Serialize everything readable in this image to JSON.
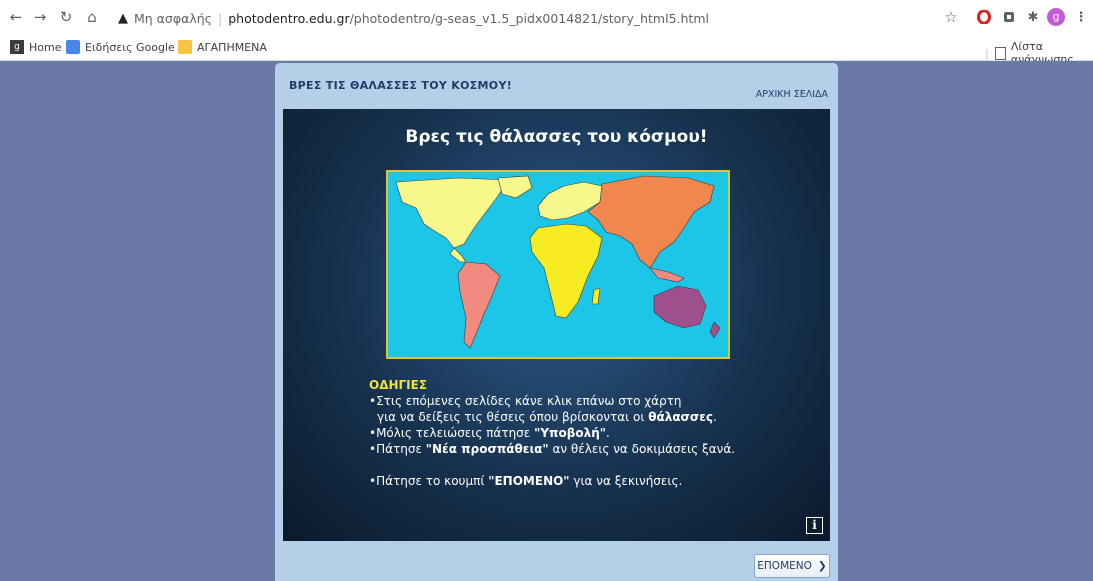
{
  "browser": {
    "security_label": "Μη ασφαλής",
    "url_domain": "photodentro.edu.gr",
    "url_path": "/photodentro/g-seas_v1.5_pidx0014821/story_html5.html",
    "profile_initial": "g",
    "reading_list_label": "Λίστα ανάγνωσης"
  },
  "bookmarks": [
    {
      "label": "Home"
    },
    {
      "label": "Ειδήσεις Google"
    },
    {
      "label": "ΑΓΑΠΗΜΕΝΑ"
    }
  ],
  "card": {
    "title": "ΒΡΕΣ ΤΙΣ ΘΑΛΑΣΣΕΣ ΤΟΥ ΚΟΣΜΟΥ!",
    "home_link": "ΑΡΧΙΚΗ ΣΕΛΙΔΑ",
    "next_label": "ΕΠΟΜΕΝΟ",
    "next_chevron": "❯"
  },
  "stage": {
    "title": "Βρες τις θάλασσες του κόσμου!",
    "instructions": {
      "heading": "ΟΔΗΓΙΕΣ",
      "bullet": "•",
      "l1": "Στις επόμενες σελίδες κάνε κλικ επάνω στο χάρτη",
      "l2a": "για να δείξεις τις θέσεις όπου βρίσκονται οι ",
      "l2b": "θάλασσες",
      "l2c": ".",
      "l3a": "Μόλις τελειώσεις πάτησε ",
      "l3b": "\"Υποβολή\"",
      "l3c": ".",
      "l4a": "Πάτησε ",
      "l4b": "\"Νέα προσπάθεια\"",
      "l4c": " αν θέλεις να δοκιμάσεις ξανά.",
      "l5a": "Πάτησε το κουμπί ",
      "l5b": "\"ΕΠΟΜΕΝΟ\"",
      "l5c": " για να ξεκινήσεις."
    },
    "info_label": "i"
  },
  "colors": {
    "ocean": "#1dc6e6",
    "north_america": "#f7f78c",
    "south_america": "#f28a80",
    "europe": "#f7f78c",
    "africa": "#f7ec22",
    "asia": "#f0874f",
    "oceania": "#a0508c"
  }
}
